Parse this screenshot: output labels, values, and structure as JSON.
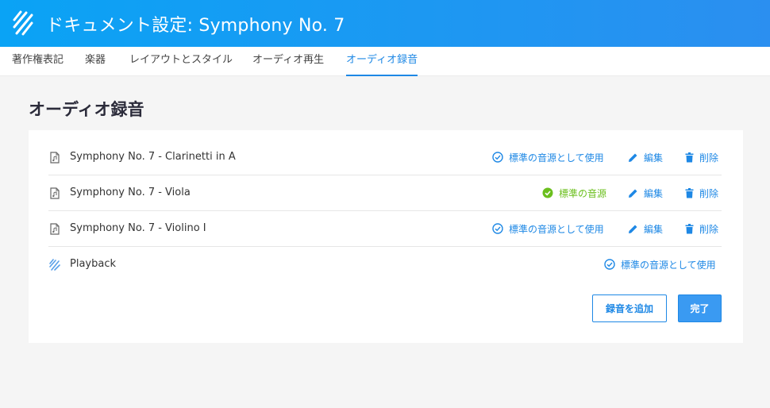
{
  "header": {
    "title": "ドキュメント設定: Symphony No. 7",
    "logo_icon": "stripes-logo-icon"
  },
  "tabs": [
    {
      "label": "著作権表記",
      "active": false
    },
    {
      "label": "楽器",
      "active": false
    },
    {
      "label": "レイアウトとスタイル",
      "active": false
    },
    {
      "label": "オーディオ再生",
      "active": false
    },
    {
      "label": "オーディオ録音",
      "active": true
    }
  ],
  "section": {
    "title": "オーディオ録音"
  },
  "recordings": [
    {
      "name": "Symphony No. 7 - Clarinetti in A",
      "icon": "audio-file-icon",
      "status_label": "標準の音源として使用",
      "is_default": false,
      "edit_label": "編集",
      "delete_label": "削除"
    },
    {
      "name": "Symphony No. 7 - Viola",
      "icon": "audio-file-icon",
      "status_label": "標準の音源",
      "is_default": true,
      "edit_label": "編集",
      "delete_label": "削除"
    },
    {
      "name": "Symphony No. 7 - Violino I",
      "icon": "audio-file-icon",
      "status_label": "標準の音源として使用",
      "is_default": false,
      "edit_label": "編集",
      "delete_label": "削除"
    },
    {
      "name": "Playback",
      "icon": "playback-stripes-icon",
      "status_label": "標準の音源として使用",
      "is_default": false
    }
  ],
  "buttons": {
    "add_recording": "録音を追加",
    "done": "完了"
  },
  "colors": {
    "accent": "#1e88e5",
    "header_start": "#0aa3f5",
    "header_end": "#2b8ff0",
    "default_green": "#6bbf1d"
  }
}
